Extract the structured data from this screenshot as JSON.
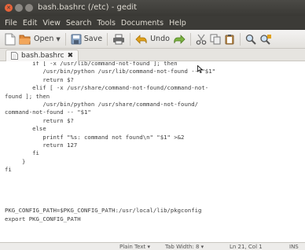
{
  "window": {
    "title": "bash.bashrc (/etc) - gedit"
  },
  "menu": [
    "File",
    "Edit",
    "View",
    "Search",
    "Tools",
    "Documents",
    "Help"
  ],
  "toolbar": {
    "open_label": "Open",
    "save_label": "Save",
    "undo_label": "Undo"
  },
  "tab": {
    "label": "bash.bashrc",
    "close": "✖"
  },
  "editor": {
    "lines": [
      "        if [ -x /usr/lib/command-not-found ]; then",
      "           /usr/bin/python /usr/lib/command-not-found -- \"$1\"",
      "           return $?",
      "        elif [ -x /usr/share/command-not-found/command-not-",
      "found ]; then",
      "           /usr/bin/python /usr/share/command-not-found/",
      "command-not-found -- \"$1\"",
      "           return $?",
      "        else",
      "           printf \"%s: command not found\\n\" \"$1\" >&2",
      "           return 127",
      "        fi",
      "     }",
      "fi",
      "",
      "",
      "",
      "",
      "PKG_CONFIG_PATH=$PKG_CONFIG_PATH:/usr/local/lib/pkgconfig",
      "export PKG_CONFIG_PATH"
    ]
  },
  "status": {
    "language": "Plain Text",
    "tab_width": "Tab Width: 8",
    "position": "Ln 21, Col 1",
    "mode": "INS"
  }
}
